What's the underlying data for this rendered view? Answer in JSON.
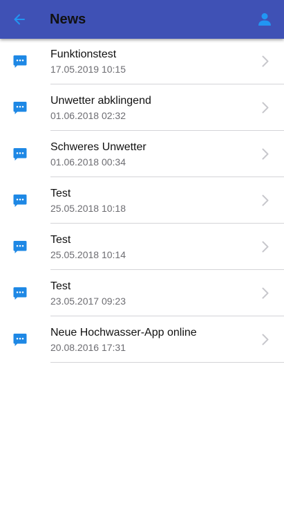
{
  "header": {
    "title": "News",
    "back_icon": "arrow-left-icon",
    "profile_icon": "person-icon",
    "background_color": "#3f51b5",
    "icon_color": "#2196f3"
  },
  "news": {
    "items": [
      {
        "title": "Funktionstest",
        "date": "17.05.2019 10:15"
      },
      {
        "title": "Unwetter abklingend",
        "date": "01.06.2018 02:32"
      },
      {
        "title": "Schweres Unwetter",
        "date": "01.06.2018 00:34"
      },
      {
        "title": "Test",
        "date": "25.05.2018 10:18"
      },
      {
        "title": "Test",
        "date": "25.05.2018 10:14"
      },
      {
        "title": "Test",
        "date": "23.05.2017 09:23"
      },
      {
        "title": "Neue Hochwasser-App online",
        "date": "20.08.2016 17:31"
      }
    ],
    "item_icon": "message-icon",
    "accent_color": "#1e88e5"
  }
}
